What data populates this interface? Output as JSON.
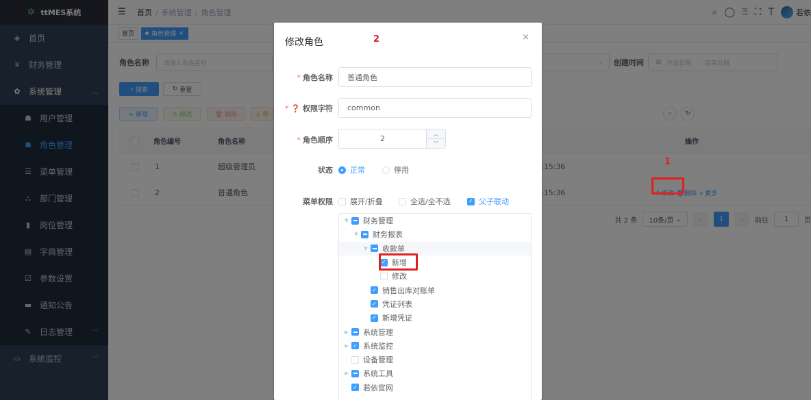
{
  "app": {
    "title": "ttMES系统"
  },
  "sidebar": {
    "items": [
      {
        "label": "首页",
        "icon": "dashboard-icon"
      },
      {
        "label": "财务管理",
        "icon": "yen-icon"
      },
      {
        "label": "系统管理",
        "icon": "gear-icon"
      }
    ],
    "sub_items": [
      {
        "label": "用户管理",
        "icon": "user-icon"
      },
      {
        "label": "角色管理",
        "icon": "peoples-icon"
      },
      {
        "label": "菜单管理",
        "icon": "tree-table-icon"
      },
      {
        "label": "部门管理",
        "icon": "tree-icon"
      },
      {
        "label": "岗位管理",
        "icon": "post-icon"
      },
      {
        "label": "字典管理",
        "icon": "dict-icon"
      },
      {
        "label": "参数设置",
        "icon": "edit-icon"
      },
      {
        "label": "通知公告",
        "icon": "message-icon"
      },
      {
        "label": "日志管理",
        "icon": "log-icon"
      }
    ],
    "bottom_item": {
      "label": "系统监控",
      "icon": "monitor-icon"
    }
  },
  "navbar": {
    "breadcrumb": [
      "首页",
      "系统管理",
      "角色管理"
    ],
    "user_name": "若依"
  },
  "tags": {
    "home": "首页",
    "active": "角色管理",
    "close": "×"
  },
  "query": {
    "role_name_label": "角色名称",
    "role_name_placeholder": "请输入角色名称",
    "created_label": "创建时间",
    "date_start": "开始日期",
    "date_sep": "-",
    "date_end": "结束日期",
    "search_btn": "搜索",
    "reset_btn": "重置"
  },
  "toolbar": {
    "add": "+ 新增",
    "edit": "✎ 修改",
    "delete": "🗑 删除",
    "export": "↓ 导"
  },
  "table": {
    "headers": [
      "角色编号",
      "角色名称",
      "操作"
    ],
    "rows": [
      {
        "id": "1",
        "name": "超级管理员",
        "time": ":15:36"
      },
      {
        "id": "2",
        "name": "普通角色",
        "time": ":15:36",
        "ops": [
          "✎修改",
          "🗑删除",
          "» 更多"
        ]
      }
    ]
  },
  "pagination": {
    "total": "共 2 条",
    "size": "10条/页",
    "page": "1",
    "goto": "前往",
    "goto_val": "1",
    "page_unit": "页"
  },
  "annotations": {
    "one": "1",
    "two": "2"
  },
  "dialog": {
    "title": "修改角色",
    "close": "×",
    "role_name_label": "角色名称",
    "role_name_value": "普通角色",
    "perm_label": "❓ 权限字符",
    "perm_value": "common",
    "order_label": "角色顺序",
    "order_value": "2",
    "status_label": "状态",
    "status_normal": "正常",
    "status_disabled": "停用",
    "menu_perm_label": "菜单权限",
    "expand_label": "展开/折叠",
    "select_all_label": "全选/全不选",
    "linkage_label": "父子联动"
  },
  "tree": [
    {
      "label": "财务管理",
      "level": 0,
      "state": "ind",
      "arrow": "down"
    },
    {
      "label": "财务报表",
      "level": 1,
      "state": "ind",
      "arrow": "down"
    },
    {
      "label": "收款单",
      "level": 2,
      "state": "ind",
      "arrow": "down",
      "highlight": true
    },
    {
      "label": "新增",
      "level": 3,
      "state": "checked",
      "arrow": ""
    },
    {
      "label": "修改",
      "level": 3,
      "state": "none",
      "arrow": ""
    },
    {
      "label": "销售出库对账单",
      "level": 2,
      "state": "checked",
      "arrow": ""
    },
    {
      "label": "凭证列表",
      "level": 2,
      "state": "checked",
      "arrow": ""
    },
    {
      "label": "新增凭证",
      "level": 2,
      "state": "checked",
      "arrow": ""
    },
    {
      "label": "系统管理",
      "level": 0,
      "state": "ind",
      "arrow": "right"
    },
    {
      "label": "系统监控",
      "level": 0,
      "state": "checked",
      "arrow": "right"
    },
    {
      "label": "设备管理",
      "level": 0,
      "state": "none",
      "arrow": ""
    },
    {
      "label": "系统工具",
      "level": 0,
      "state": "ind",
      "arrow": "right"
    },
    {
      "label": "若依官网",
      "level": 0,
      "state": "checked",
      "arrow": ""
    }
  ]
}
